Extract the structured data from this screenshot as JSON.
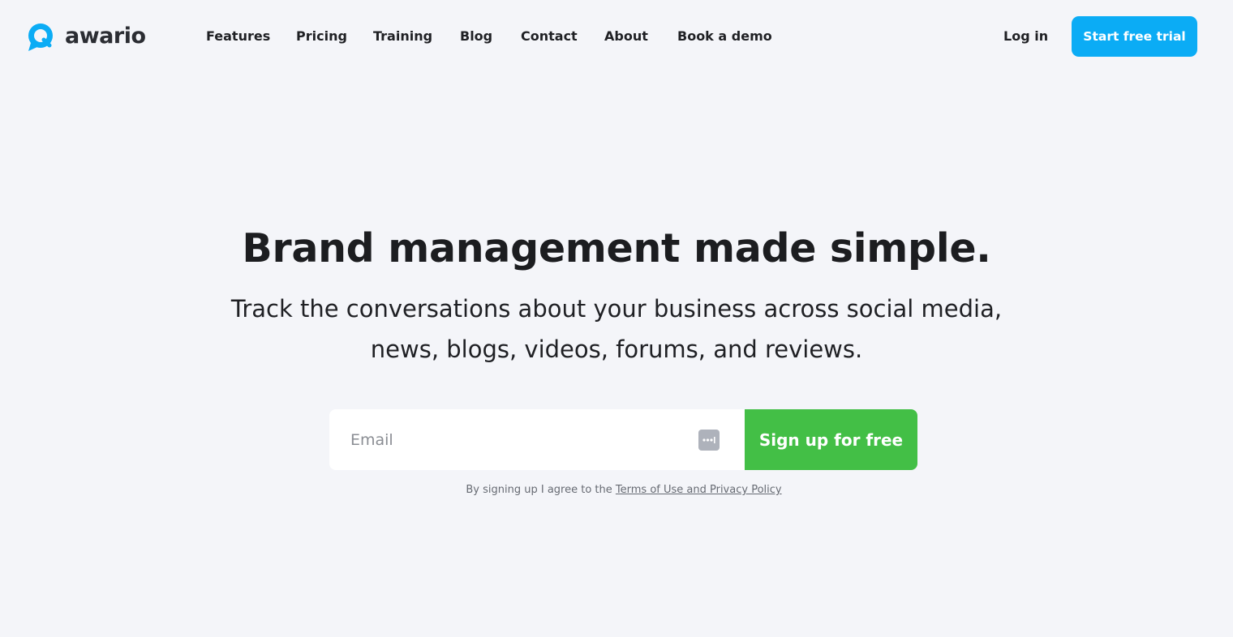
{
  "brand": {
    "name": "awario",
    "accent": "#0bacf5"
  },
  "nav": {
    "items": [
      {
        "label": "Features"
      },
      {
        "label": "Pricing"
      },
      {
        "label": "Training"
      },
      {
        "label": "Blog"
      },
      {
        "label": "Contact"
      },
      {
        "label": "About"
      },
      {
        "label": "Book a demo"
      }
    ],
    "login_label": "Log in",
    "trial_label": "Start free trial"
  },
  "hero": {
    "title": "Brand management made simple.",
    "subtitle_line1": "Track the conversations about your business across social media,",
    "subtitle_line2": "news, blogs, videos, forums, and reviews."
  },
  "signup": {
    "email_placeholder": "Email",
    "button_label": "Sign up for free",
    "button_color": "#43bf46",
    "terms_prefix": "By signing up I agree to the ",
    "terms_link": "Terms of Use and Privacy Policy",
    "autofill_icon": "password-autofill-icon"
  }
}
